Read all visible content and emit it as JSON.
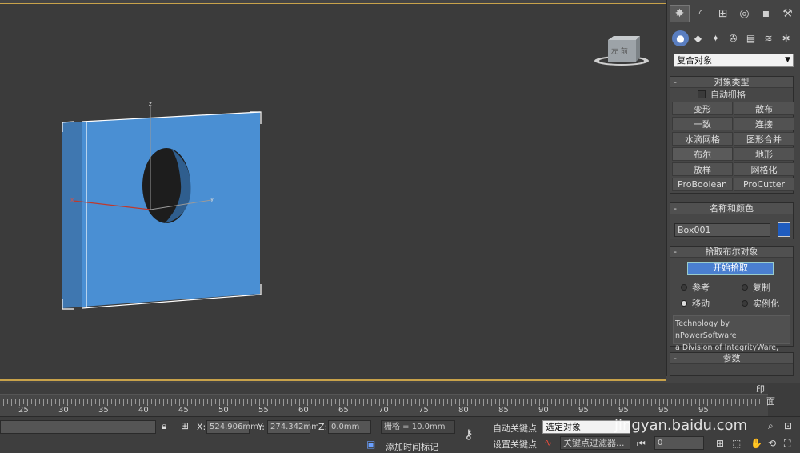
{
  "command_panel": {
    "dropdown_value": "复合对象",
    "object_type": {
      "title": "对象类型",
      "autogrid_label": "自动栅格",
      "buttons": [
        "变形",
        "散布",
        "一致",
        "连接",
        "水滴网格",
        "图形合并",
        "布尔",
        "地形",
        "放样",
        "网格化",
        "ProBoolean",
        "ProCutter"
      ]
    },
    "name_color": {
      "title": "名称和颜色",
      "name_value": "Box001",
      "color": "#1f5cbf"
    },
    "pick_boolean": {
      "title": "拾取布尔对象",
      "pick_button": "开始拾取",
      "radio_reference": "参考",
      "radio_copy": "复制",
      "radio_move": "移动",
      "radio_instance": "实例化",
      "tech_line1": "Technology by nPowerSoftware",
      "tech_line2": "a Division of IntegrityWare, Inc."
    },
    "params_title": "参数",
    "partial_text_1": "印",
    "partial_text_2": "面"
  },
  "viewport": {
    "gizmo_axes": {
      "x": "x",
      "y": "y",
      "z": "z"
    },
    "viewcube_label": "左 前"
  },
  "timeline": {
    "ticks": [
      "25",
      "30",
      "35",
      "40",
      "45",
      "50",
      "55",
      "60",
      "65",
      "70",
      "75",
      "80",
      "85",
      "90",
      "95",
      "95",
      "95",
      "95"
    ]
  },
  "status_bar": {
    "x_label": "X:",
    "x_value": "524.906mm",
    "y_label": "Y:",
    "y_value": "274.342mm",
    "z_label": "Z:",
    "z_value": "0.0mm",
    "grid_label": "栅格 = 10.0mm",
    "add_time_tag": "添加时间标记",
    "auto_key": "自动关键点",
    "set_key": "设置关键点",
    "selected_object": "选定对象",
    "key_filter": "关键点过滤器...",
    "frame_value": "0",
    "watermark": "jingyan.baidu.com"
  },
  "colors": {
    "object_blue": "#4a8fd3",
    "accent_orange": "#c8a24a",
    "viewport_bg": "#3b3b3b"
  }
}
